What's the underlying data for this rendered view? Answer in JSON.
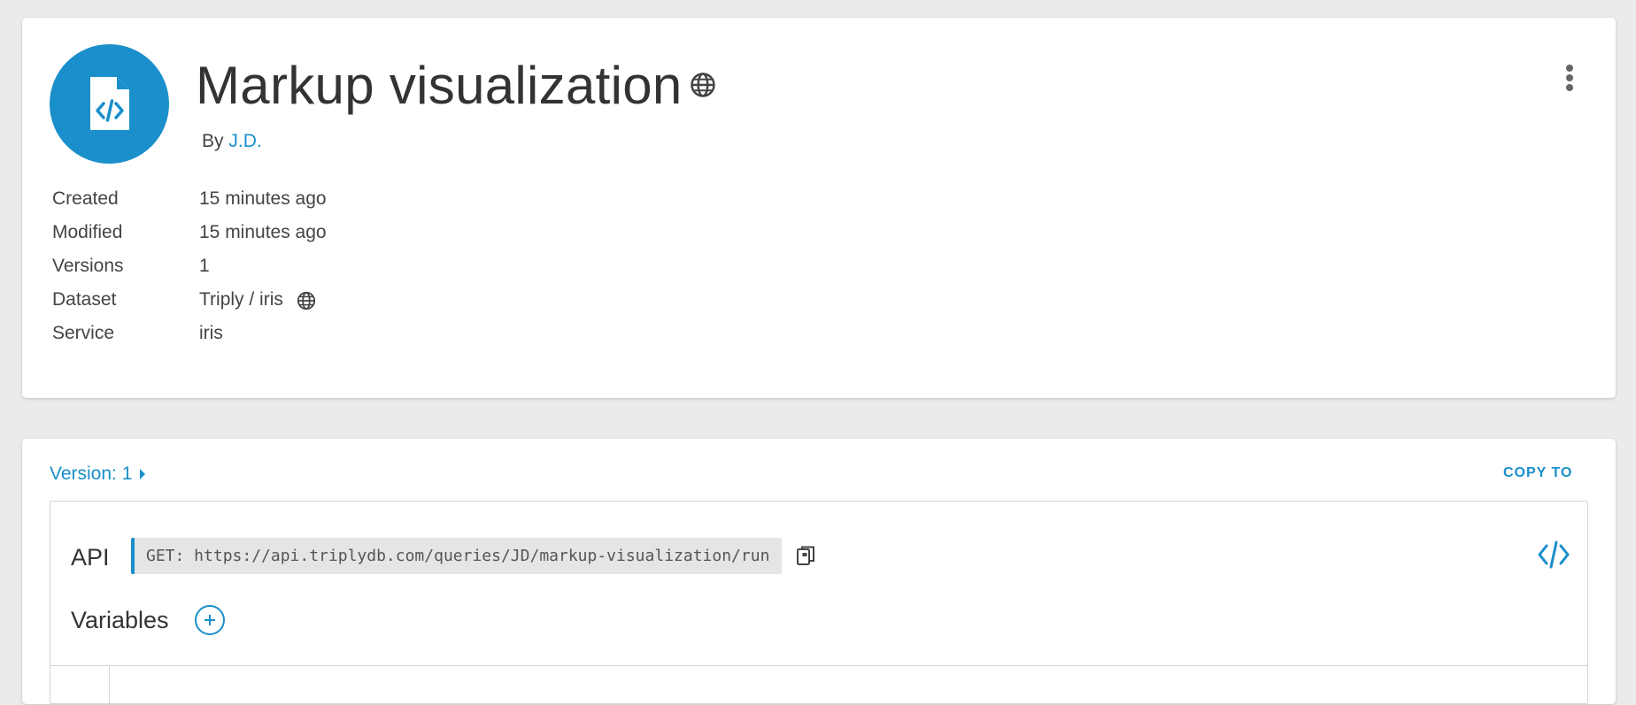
{
  "header": {
    "title": "Markup visualization",
    "byline_prefix": "By",
    "author": "J.D."
  },
  "meta": {
    "created_label": "Created",
    "created_value": "15 minutes ago",
    "modified_label": "Modified",
    "modified_value": "15 minutes ago",
    "versions_label": "Versions",
    "versions_value": "1",
    "dataset_label": "Dataset",
    "dataset_value": "Triply / iris",
    "service_label": "Service",
    "service_value": "iris"
  },
  "version": {
    "label": "Version: 1",
    "copy_to": "COPY TO"
  },
  "api": {
    "label": "API",
    "url": "GET: https://api.triplydb.com/queries/JD/markup-visualization/run"
  },
  "variables": {
    "label": "Variables"
  },
  "colors": {
    "accent": "#1a8fcb",
    "background": "#eaebec"
  },
  "icons": [
    "file-code-icon",
    "globe-icon",
    "more-vert-icon",
    "caret-right-icon",
    "copy-icon",
    "code-icon",
    "add-circle-icon"
  ]
}
